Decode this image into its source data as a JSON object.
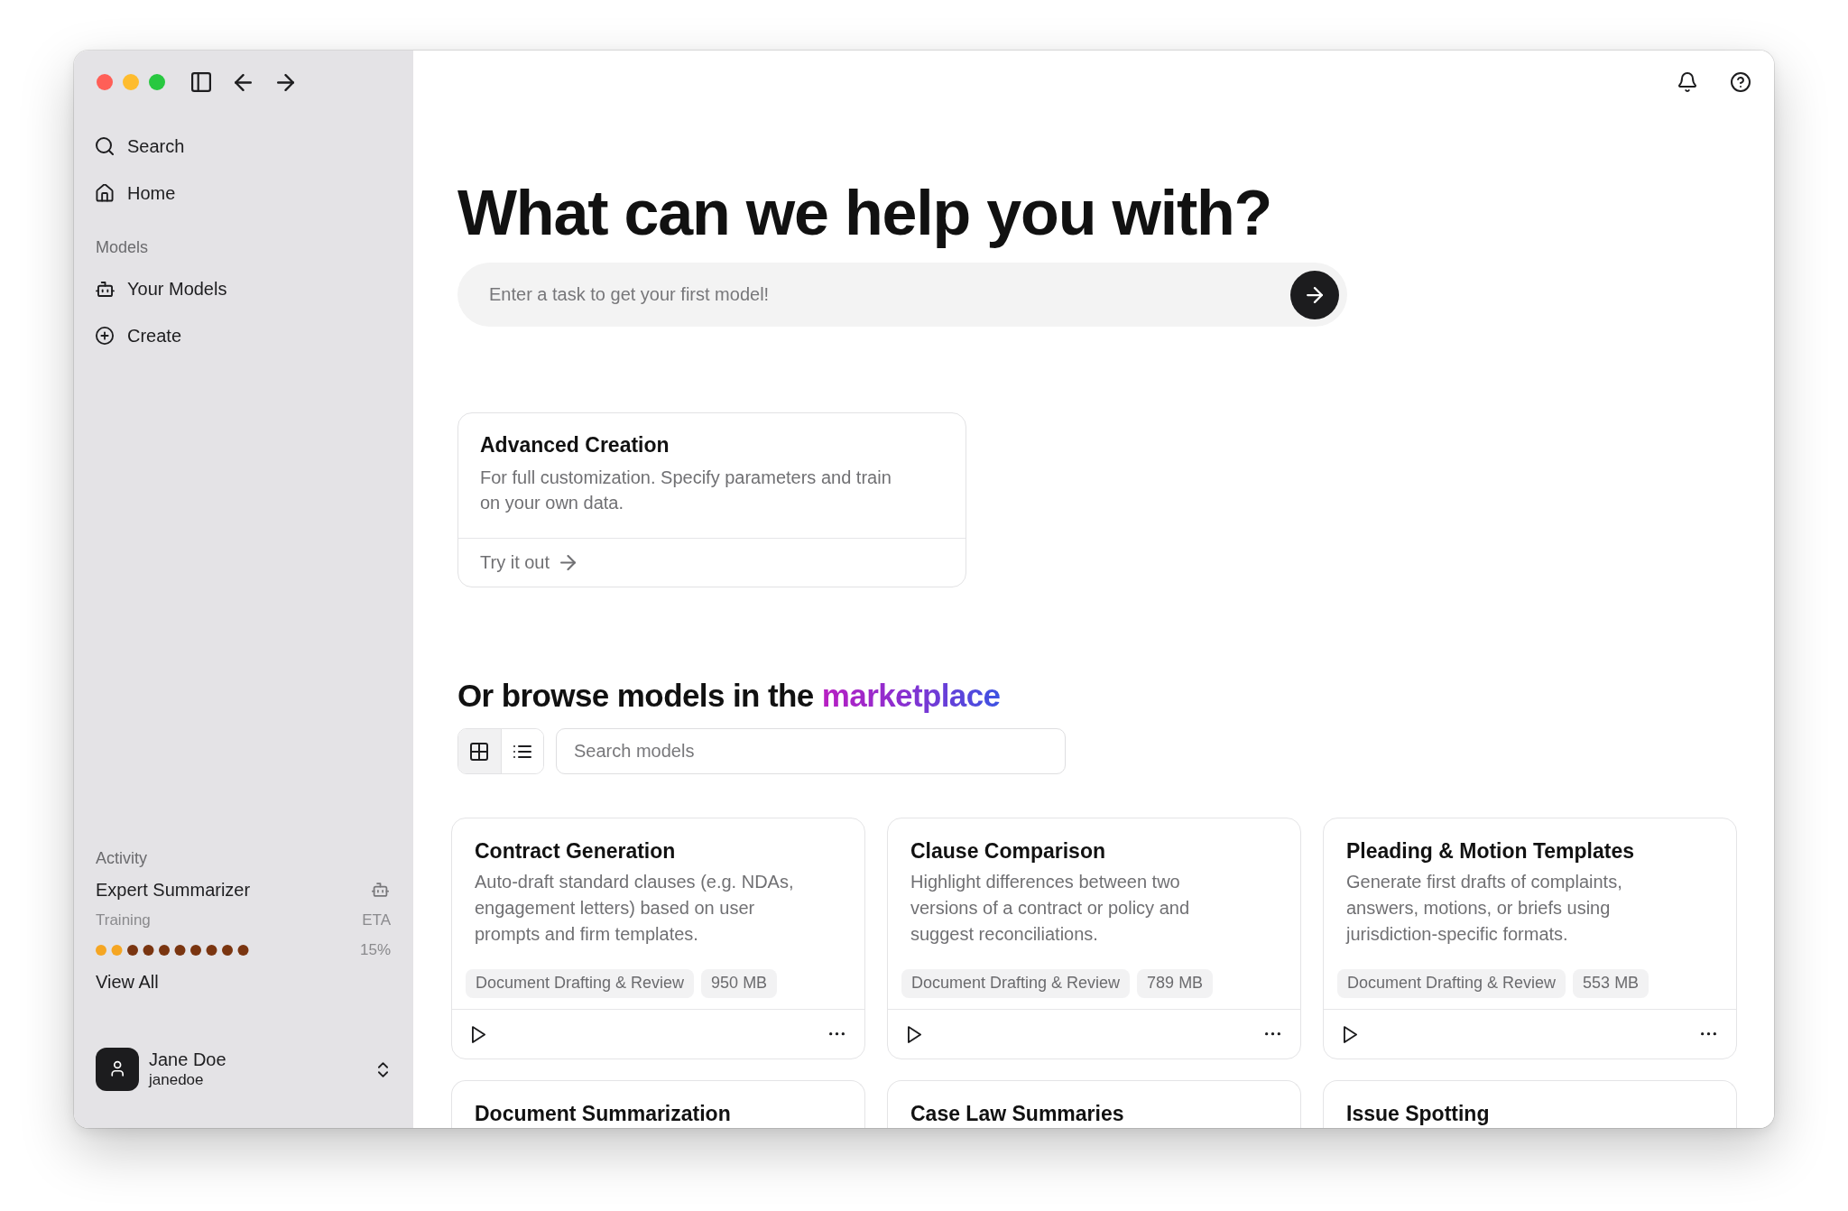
{
  "sidebar": {
    "nav": [
      {
        "kind": "search",
        "label": "Search",
        "selected": false
      },
      {
        "kind": "home",
        "label": "Home",
        "selected": false
      }
    ],
    "sections": [
      {
        "title": "Models",
        "items": [
          {
            "kind": "robot",
            "label": "Your Models",
            "selected": false
          },
          {
            "kind": "plus",
            "label": "Create",
            "selected": false
          }
        ]
      }
    ],
    "activity": {
      "title": "Activity",
      "jobs": [
        {
          "name": "Expert Summarizer",
          "status": "Training",
          "eta_label": "ETA",
          "progress": "15%",
          "level": 0.2
        }
      ],
      "link": "View All"
    },
    "user": {
      "name": "Jane Doe",
      "username": "janedoe"
    }
  },
  "main": {
    "heading": "What can we help you with?",
    "task_input": {
      "placeholder": "Enter a task to get your first model!"
    },
    "advanced_card": {
      "title": "Advanced Creation",
      "description": "For full customization. Specify parameters and train on your own data.",
      "action": "Try it out"
    },
    "marketplace": {
      "heading": "Or browse models in the",
      "heading_highlight": "marketplace",
      "view_modes": [
        {
          "kind": "grid",
          "selected": true
        },
        {
          "kind": "list",
          "selected": false
        }
      ],
      "search": {
        "placeholder": "Search models"
      },
      "models": [
        {
          "title": "Contract Generation",
          "description": "Auto-draft standard clauses (e.g. NDAs, engagement letters) based on user prompts and firm templates.",
          "category": "Document Drafting & Review",
          "size": "950 MB"
        },
        {
          "title": "Clause Comparison",
          "description": "Highlight differences between two versions of a contract or policy and suggest reconciliations.",
          "category": "Document Drafting & Review",
          "size": "789 MB"
        },
        {
          "title": "Pleading & Motion Templates",
          "description": "Generate first drafts of complaints, answers, motions, or briefs using jurisdiction-specific formats.",
          "category": "Document Drafting & Review",
          "size": "553 MB"
        },
        {
          "title": "Document Summarization"
        },
        {
          "title": "Case Law Summaries"
        },
        {
          "title": "Issue Spotting"
        }
      ]
    }
  }
}
